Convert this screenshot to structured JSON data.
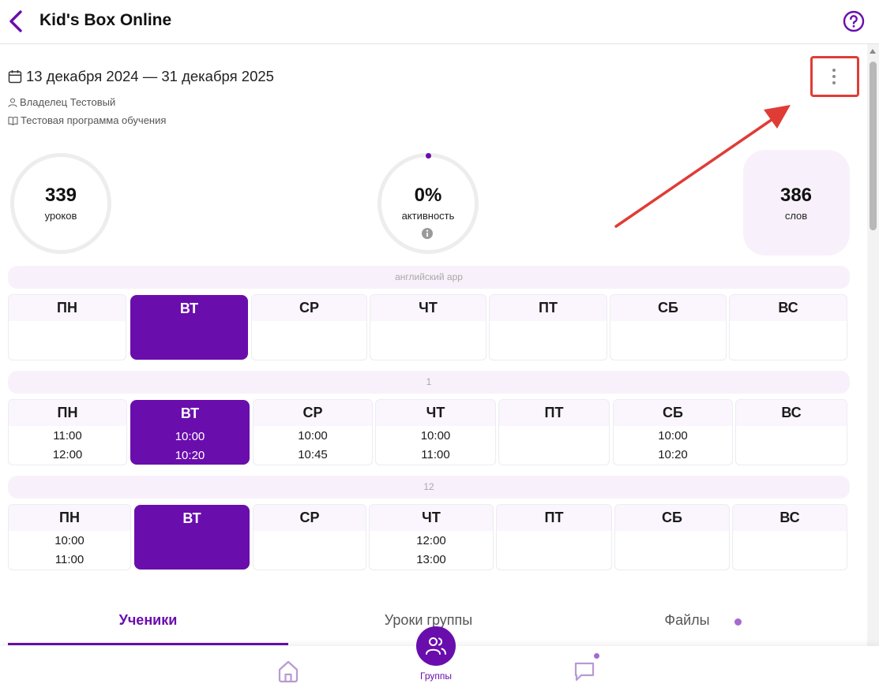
{
  "header": {
    "title": "Kid's Box Online"
  },
  "group_info": {
    "period": "13 декабря 2024 — 31 декабря 2025",
    "owner": "Владелец Тестовый",
    "program": "Тестовая программа обучения"
  },
  "stats": {
    "lessons": {
      "value": "339",
      "label": "уроков"
    },
    "activity": {
      "value": "0%",
      "label": "активность"
    },
    "words": {
      "value": "386",
      "label": "слов"
    }
  },
  "schedules": [
    {
      "name": "английский app",
      "days": [
        {
          "label": "ПН",
          "start": "",
          "end": ""
        },
        {
          "label": "ВТ",
          "start": "",
          "end": ""
        },
        {
          "label": "СР",
          "start": "",
          "end": ""
        },
        {
          "label": "ЧТ",
          "start": "",
          "end": ""
        },
        {
          "label": "ПТ",
          "start": "",
          "end": ""
        },
        {
          "label": "СБ",
          "start": "",
          "end": ""
        },
        {
          "label": "ВС",
          "start": "",
          "end": ""
        }
      ]
    },
    {
      "name": "1",
      "days": [
        {
          "label": "ПН",
          "start": "11:00",
          "end": "12:00"
        },
        {
          "label": "ВТ",
          "start": "10:00",
          "end": "10:20"
        },
        {
          "label": "СР",
          "start": "10:00",
          "end": "10:45"
        },
        {
          "label": "ЧТ",
          "start": "10:00",
          "end": "11:00"
        },
        {
          "label": "ПТ",
          "start": "",
          "end": ""
        },
        {
          "label": "СБ",
          "start": "10:00",
          "end": "10:20"
        },
        {
          "label": "ВС",
          "start": "",
          "end": ""
        }
      ]
    },
    {
      "name": "12",
      "days": [
        {
          "label": "ПН",
          "start": "10:00",
          "end": "11:00"
        },
        {
          "label": "ВТ",
          "start": "",
          "end": ""
        },
        {
          "label": "СР",
          "start": "",
          "end": ""
        },
        {
          "label": "ЧТ",
          "start": "12:00",
          "end": "13:00"
        },
        {
          "label": "ПТ",
          "start": "",
          "end": ""
        },
        {
          "label": "СБ",
          "start": "",
          "end": ""
        },
        {
          "label": "ВС",
          "start": "",
          "end": ""
        }
      ]
    }
  ],
  "tabs": [
    {
      "label": "Ученики",
      "active": true
    },
    {
      "label": "Уроки группы",
      "active": false
    },
    {
      "label": "Файлы",
      "active": false
    }
  ],
  "bottom_nav": {
    "groups_label": "Группы"
  },
  "colors": {
    "accent": "#6a0dad",
    "highlight": "#e03c36",
    "tint": "#f8f1fb"
  },
  "icons": [
    "chevron-left-icon",
    "help-icon",
    "calendar-icon",
    "user-icon",
    "book-icon",
    "more-vertical-icon",
    "info-icon",
    "home-icon",
    "users-icon",
    "chat-icon"
  ]
}
